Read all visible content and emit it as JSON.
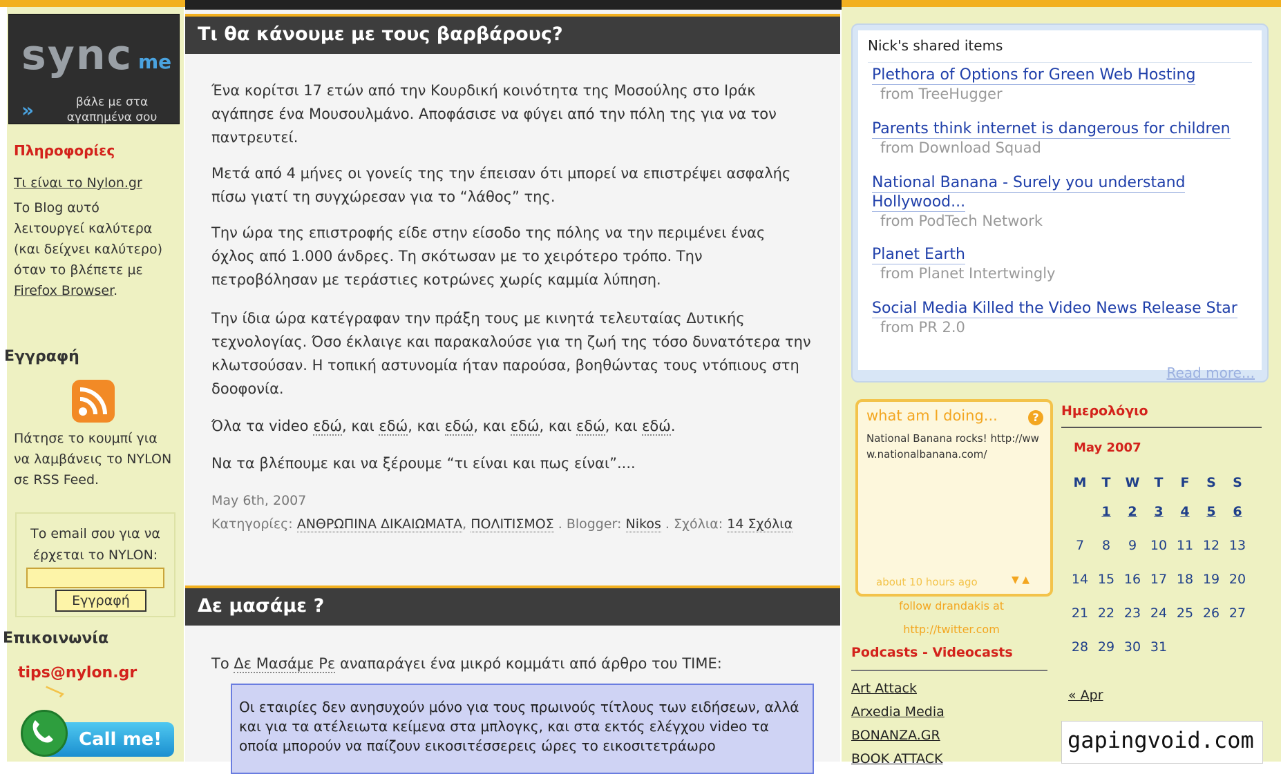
{
  "sync": {
    "logo": "sync",
    "me": "me",
    "tagline": "βάλε με στα αγαπημένα σου"
  },
  "left": {
    "info_heading": "Πληροφορίες",
    "about_link": "Τι είναι το Nylon.gr",
    "blog_note_pre": "Το Blog αυτό λειτουργεί καλύτερα (και δείχνει καλύτερο) όταν το βλέπετε με ",
    "blog_note_link": "Firefox Browser",
    "blog_note_post": ".",
    "signup_heading": "Εγγραφή",
    "rss_text": "Πάτησε το κουμπί για να λαμβάνεις το NYLON σε RSS Feed.",
    "email_text": "Το email σου για να έρχεται το NYLON:",
    "email_value": "",
    "subscribe_button": "Εγγραφή",
    "contact_heading": "Επικοινωνία",
    "tips_email": "tips@nylon.gr",
    "callme": "Call me!"
  },
  "post1": {
    "title": "Τι θα κάνουμε με τους βαρβάρους?",
    "p1": "Ένα κορίτσι 17 ετών από την Κουρδική κοινότητα της Μοσούλης στο Ιράκ αγάπησε ένα Μουσουλμάνο. Αποφάσισε να φύγει από την πόλη της για να τον παντρευτεί.",
    "p2": "Μετά από 4 μήνες οι γονείς της την έπεισαν ότι μπορεί να επιστρέψει ασφαλής πίσω γιατί τη συγχώρεσαν για το “λάθος” της.",
    "p3": "Την ώρα της επιστροφής είδε στην είσοδο της πόλης να την περιμένει ένας όχλος από 1.000 άνδρες. Τη σκότωσαν με το χειρότερο τρόπο. Την πετροβόλησαν με τεράστιες κοτρώνες χωρίς καμμία λύπηση.",
    "p4": "Την ίδια ώρα κατέγραφαν την πράξη τους με κινητά τελευταίας Δυτικής τεχνολογίας. Όσο έκλαιγε και παρακαλούσε για τη ζωή της τόσο δυνατότερα την κλωτσούσαν. Η τοπική αστυνομία ήταν παρούσα, βοηθώντας τους ντόπιους στη δοοφονία.",
    "p5_pre": "Όλα τα video",
    "here": "εδώ",
    "and": "και",
    "p6": "Να τα βλέπουμε και να ξέρουμε “τι είναι και πως είναι”....",
    "date": "May 6th, 2007",
    "cat_label": "Κατηγορίες:",
    "cat1": "ΑΝΘΡΩΠΙΝΑ ΔΙΚΑΙΩΜΑΤΑ",
    "cat2": "ΠΟΛΙΤΙΣΜΟΣ",
    "blogger_label": ". Blogger:",
    "blogger": "Nikos",
    "comments_label": ". Σχόλια:",
    "comments": "14 Σχόλια"
  },
  "post2": {
    "title": "Δε μασάμε ?",
    "intro_pre": "Το",
    "intro_link": "Δε Μασάμε Ρε",
    "intro_post": "αναπαράγει ένα μικρό κομμάτι από άρθρο του TIME:",
    "quote": "Οι εταιρίες δεν ανησυχούν μόνο για τους πρωινούς τίτλους των ειδήσεων, αλλά και για τα ατέλειωτα κείμενα στα μπλογκς, και στα εκτός ελέγχου video τα οποία μπορούν να παίζουν εικοσιτέσσερεις ώρες το εικοσιτετράωρο"
  },
  "shared": {
    "heading": "Nick's shared items",
    "items": [
      {
        "title": "Plethora of Options for Green Web Hosting",
        "source": "from TreeHugger"
      },
      {
        "title": "Parents think internet is dangerous for children",
        "source": "from Download Squad"
      },
      {
        "title_l1": "National Banana - Surely you understand",
        "title_l2": "Hollywood...",
        "source": "from PodTech Network"
      },
      {
        "title": "Planet Earth",
        "source": "from Planet Intertwingly"
      },
      {
        "title": "Social Media Killed the Video News Release Star",
        "source": "from PR 2.0"
      }
    ],
    "read_more": "Read more..."
  },
  "twitter": {
    "heading": "what am I doing...",
    "q": "?",
    "status": "National Banana rocks! http://www.nationalbanana.com/",
    "time": "about 10 hours ago",
    "arrows": "▼ ▲",
    "follow1": "follow drandakis at",
    "follow2": "http://twitter.com"
  },
  "podcasts": {
    "heading": "Podcasts - Videocasts",
    "items": [
      "Art Attack",
      "Arxedia Media",
      "BONANZA.GR",
      "BOOK ATTACK"
    ]
  },
  "calendar": {
    "heading": "Ημερολόγιο",
    "month": "May 2007",
    "days": [
      "M",
      "T",
      "W",
      "T",
      "F",
      "S",
      "S"
    ],
    "w1": [
      "",
      "1",
      "2",
      "3",
      "4",
      "5",
      "6"
    ],
    "w2": [
      "7",
      "8",
      "9",
      "10",
      "11",
      "12",
      "13"
    ],
    "w3": [
      "14",
      "15",
      "16",
      "17",
      "18",
      "19",
      "20"
    ],
    "w4": [
      "21",
      "22",
      "23",
      "24",
      "25",
      "26",
      "27"
    ],
    "w5": [
      "28",
      "29",
      "30",
      "31",
      "",
      "",
      ""
    ],
    "prev": "« Apr",
    "gapingvoid": "gapingvoid.com"
  },
  "colors": {
    "accent": "#f2b01f",
    "red": "#d3221b",
    "sidebar_bg": "#eef1c2",
    "header_bar": "#3d3d3d",
    "link_blue": "#1f3faa"
  }
}
